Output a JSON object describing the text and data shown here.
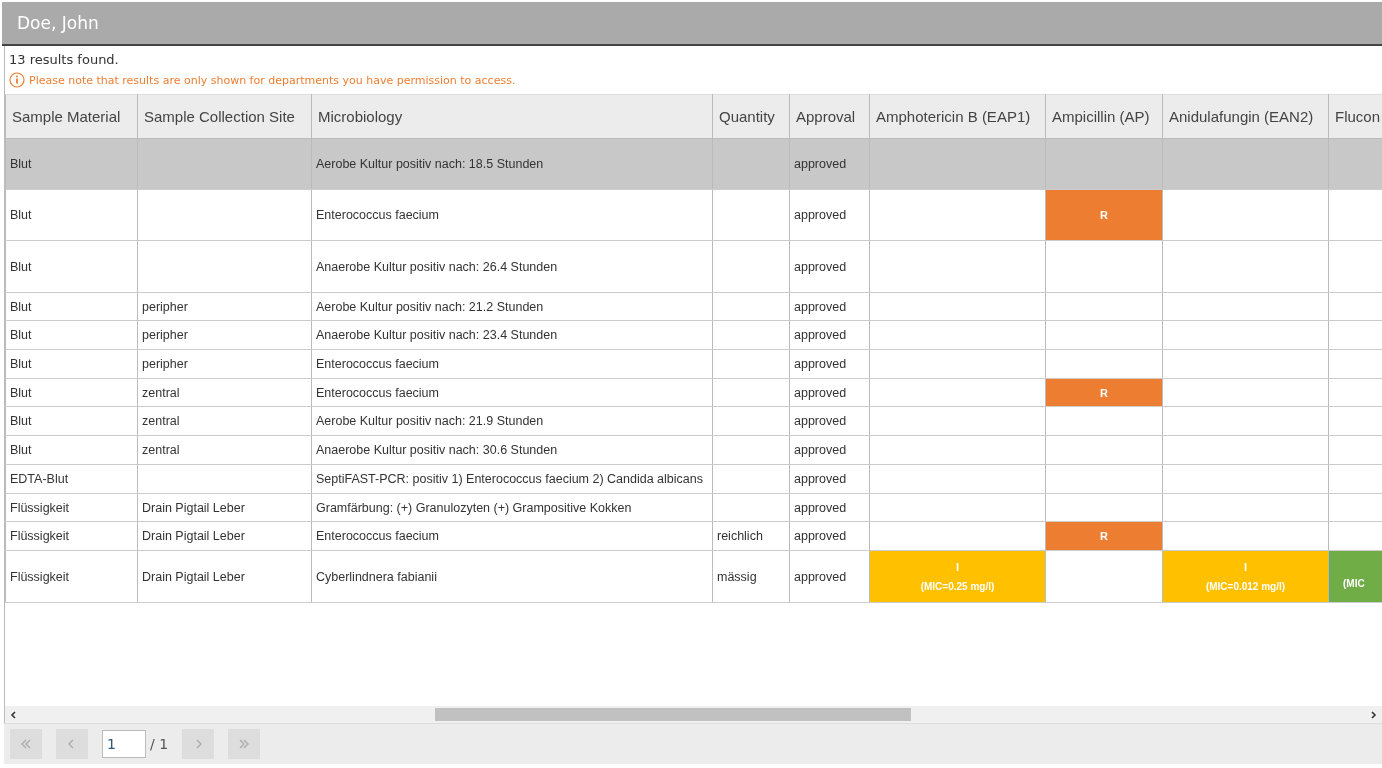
{
  "header": {
    "title": "Doe, John"
  },
  "result_count": "13 results found.",
  "notice": "Please note that results are only shown for departments you have permission to access.",
  "table": {
    "columns": [
      "Sample Material",
      "Sample Collection Site",
      "Microbiology",
      "Quantity",
      "Approval",
      "Amphotericin B (EAP1)",
      "Ampicillin (AP)",
      "Anidulafungin (EAN2)",
      "Flucon"
    ],
    "rows": [
      {
        "selected": true,
        "material": "Blut",
        "microbiology": "Aerobe Kultur positiv nach: 18.5 Stunden",
        "approval": "approved"
      },
      {
        "selected": false,
        "material": "Blut",
        "microbiology": "Enterococcus faecium",
        "approval": "approved",
        "ampicillin": {
          "result": "R",
          "color": "#ed7d31"
        }
      },
      {
        "selected": false,
        "material": "Blut",
        "microbiology": "Anaerobe Kultur positiv nach: 26.4 Stunden",
        "approval": "approved"
      },
      {
        "selected": false,
        "material": "Blut",
        "site": "peripher",
        "microbiology": "Aerobe Kultur positiv nach: 21.2 Stunden",
        "approval": "approved"
      },
      {
        "selected": false,
        "material": "Blut",
        "site": "peripher",
        "microbiology": "Anaerobe Kultur positiv nach: 23.4 Stunden",
        "approval": "approved"
      },
      {
        "selected": false,
        "material": "Blut",
        "site": "peripher",
        "microbiology": "Enterococcus faecium",
        "approval": "approved"
      },
      {
        "selected": false,
        "material": "Blut",
        "site": "zentral",
        "microbiology": "Enterococcus faecium",
        "approval": "approved",
        "ampicillin": {
          "result": "R",
          "color": "#ed7d31"
        }
      },
      {
        "selected": false,
        "material": "Blut",
        "site": "zentral",
        "microbiology": "Aerobe Kultur positiv nach: 21.9 Stunden",
        "approval": "approved"
      },
      {
        "selected": false,
        "material": "Blut",
        "site": "zentral",
        "microbiology": "Anaerobe Kultur positiv nach: 30.6 Stunden",
        "approval": "approved"
      },
      {
        "selected": false,
        "material": "EDTA-Blut",
        "microbiology": "SeptiFAST-PCR: positiv 1) Enterococcus faecium 2) Candida albicans",
        "approval": "approved"
      },
      {
        "selected": false,
        "material": "Flüssigkeit",
        "site": "Drain Pigtail Leber",
        "microbiology": "Gramfärbung: (+) Granulozyten (+) Grampositive Kokken",
        "approval": "approved"
      },
      {
        "selected": false,
        "material": "Flüssigkeit",
        "site": "Drain Pigtail Leber",
        "microbiology": "Enterococcus faecium",
        "quantity": "reichlich",
        "approval": "approved",
        "ampicillin": {
          "result": "R",
          "color": "#ed7d31"
        }
      },
      {
        "selected": false,
        "material": "Flüssigkeit",
        "site": "Drain Pigtail Leber",
        "microbiology": "Cyberlindnera fabianii",
        "quantity": "mässig",
        "approval": "approved",
        "amphotericin_b": {
          "result": "I",
          "mic": "(MIC=0.25 mg/l)",
          "color": "#ffc000"
        },
        "anidulafungin": {
          "result": "I",
          "mic": "(MIC=0.012 mg/l)",
          "color": "#ffc000"
        },
        "column_9": {
          "mic": "(MIC",
          "color": "#70ad47"
        }
      }
    ]
  },
  "pagination": {
    "page": "1",
    "total": "/ 1"
  }
}
